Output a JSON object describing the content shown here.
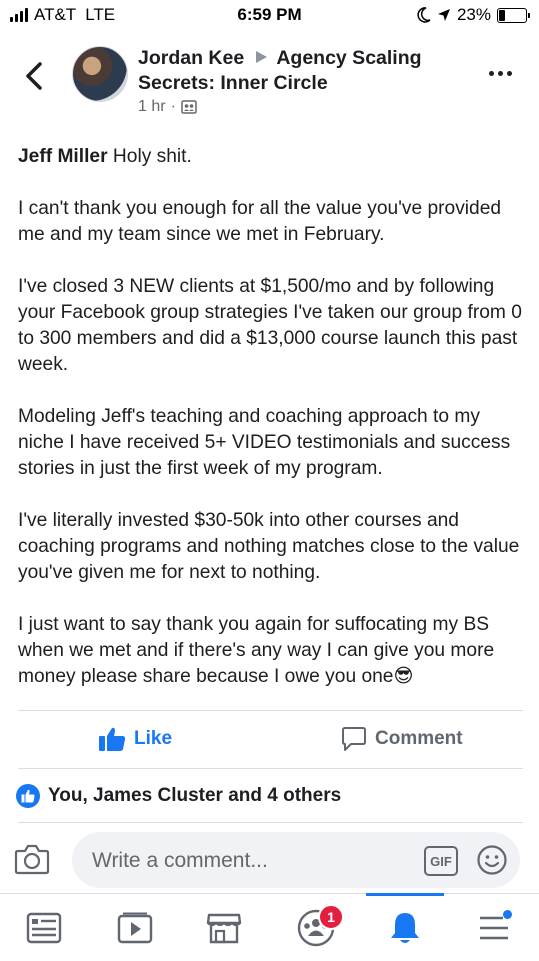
{
  "status_bar": {
    "carrier": "AT&T",
    "network": "LTE",
    "time": "6:59 PM",
    "battery": "23%"
  },
  "header": {
    "author": "Jordan Kee",
    "group": "Agency Scaling Secrets: Inner Circle",
    "timestamp": "1 hr",
    "separator": "·",
    "icons": [
      "back-chevron-icon",
      "group-privacy-icon",
      "more-options-icon"
    ]
  },
  "post": {
    "tagged_name": "Jeff Miller",
    "paragraphs": [
      "Holy shit.",
      "I can't thank you enough for all the value you've provided me and my team since we met in February.",
      "I've closed 3 NEW clients at $1,500/mo and by following your Facebook group strategies I've taken our group from 0 to 300 members and did a $13,000 course launch this past week.",
      "Modeling Jeff's teaching and coaching approach to my niche I have received 5+ VIDEO testimonials and success stories in just the first week of my program.",
      "I've literally invested $30-50k into other courses and coaching programs and nothing matches close to the value you've given me for next to nothing.",
      "I just want to say thank you again for suffocating my BS when we met and if there's any way I can give you more money please share because I owe you one"
    ],
    "end_emoji": "😎"
  },
  "actions": {
    "like_label": "Like",
    "comment_label": "Comment"
  },
  "reactions": {
    "summary": "You, James Cluster and 4 others"
  },
  "composer": {
    "placeholder": "Write a comment...",
    "gif_label": "GIF"
  },
  "navbar": {
    "items": [
      "news-feed-icon",
      "watch-icon",
      "marketplace-icon",
      "groups-icon",
      "notifications-icon",
      "menu-icon"
    ],
    "groups_badge": "1",
    "active": "notifications-icon"
  },
  "colors": {
    "accent": "#1877f2",
    "badge": "#e41e3f",
    "secondary_text": "#65676b"
  }
}
